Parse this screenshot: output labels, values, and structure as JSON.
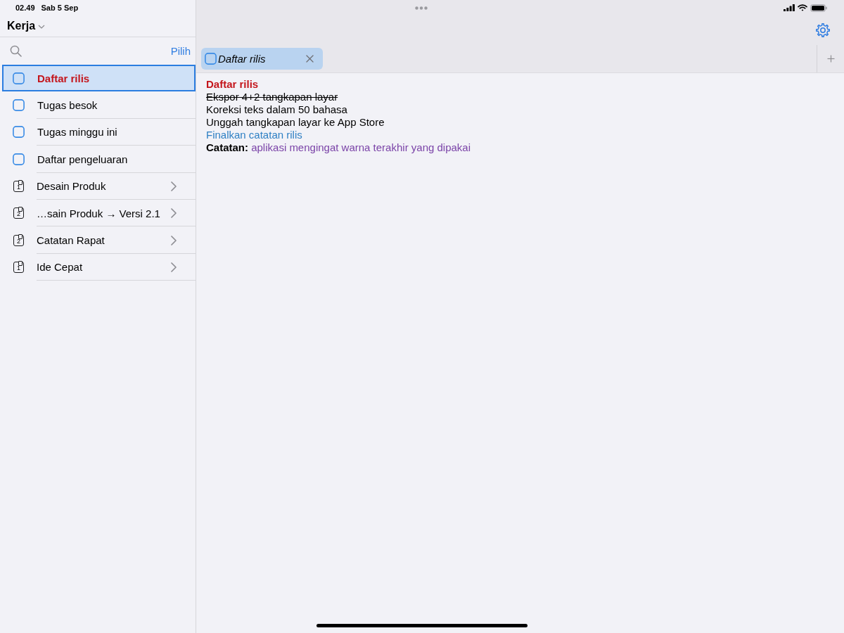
{
  "status_bar": {
    "time": "02.49",
    "date": "Sab 5 Sep"
  },
  "sidebar": {
    "folder": "Kerja",
    "select_action": "Pilih",
    "items": [
      {
        "label": "Daftar rilis",
        "kind": "note",
        "selected": true
      },
      {
        "label": "Tugas besok",
        "kind": "note",
        "selected": false
      },
      {
        "label": "Tugas minggu ini",
        "kind": "note",
        "selected": false
      },
      {
        "label": "Daftar pengeluaran",
        "kind": "note",
        "selected": false
      },
      {
        "label": "Desain Produk",
        "kind": "group",
        "count": "1",
        "selected": false
      },
      {
        "label": "…sain Produk → Versi 2.1",
        "kind": "group",
        "count": "2",
        "selected": false
      },
      {
        "label": "Catatan Rapat",
        "kind": "group",
        "count": "2",
        "selected": false
      },
      {
        "label": "Ide Cepat",
        "kind": "group",
        "count": "1",
        "selected": false
      }
    ]
  },
  "tabs": [
    {
      "label": "Daftar rilis",
      "selected": true
    }
  ],
  "editor": {
    "lines": [
      {
        "kind": "heading",
        "text": "Daftar rilis"
      },
      {
        "kind": "done",
        "text": "Ekspor 4+2 tangkapan layar"
      },
      {
        "kind": "task",
        "text": "Koreksi teks dalam 50 bahasa"
      },
      {
        "kind": "task",
        "text": "Unggah tangkapan layar ke App Store"
      },
      {
        "kind": "link",
        "text": "Finalkan catatan rilis"
      },
      {
        "kind": "note",
        "text": "**Catatan:** aplikasi mengingat warna terakhir yang dipakai"
      }
    ]
  }
}
